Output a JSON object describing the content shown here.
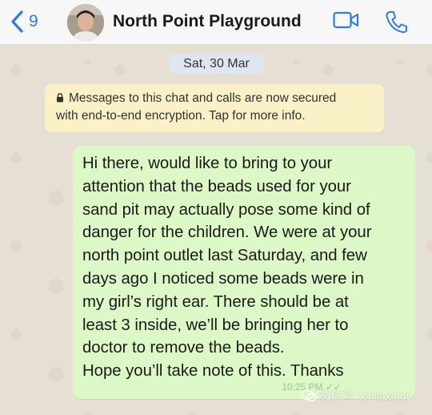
{
  "header": {
    "back_count": "9",
    "title": "North Point Playground"
  },
  "chat": {
    "date": "Sat, 30 Mar",
    "notice": [
      "Messages to this chat and calls are now secured",
      "with end-to-end encryption. Tap for more info."
    ],
    "message_lines": [
      "Hi there, would like to bring to your",
      "attention that the beads used for your",
      "sand pit may actually pose some kind of",
      "danger for the children. We were at your",
      "north point outlet last Saturday, and few",
      "days ago I noticed some beads were in",
      "my girl’s right ear. There should be at",
      "least 3 inside, we’ll be bringing her to",
      "doctor to remove the beads.",
      "Hope you’ll take note of this. Thanks"
    ],
    "message_time": "10:25 PM ✓✓"
  },
  "watermark": {
    "text": "微信号: xinjiaxingo"
  },
  "colors": {
    "accent": "#2b7cf0",
    "bubble": "#dcf8c6",
    "notice": "#fbf1c7",
    "date_pill": "#dde6f2"
  }
}
